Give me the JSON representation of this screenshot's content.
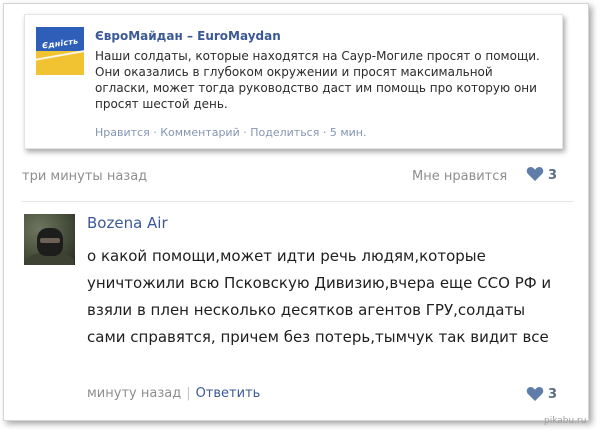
{
  "post": {
    "avatar_text": "Єдність",
    "author": "ЄвроМайдан – EuroMaydan",
    "text": "Наши солдаты, которые находятся на Саур-Могиле просят о помощи. Они оказались в глубоком окружении и просят максимальной огласки, может тогда руководство даст им помощь про которую они просят шестой день.",
    "actions": {
      "like": "Нравится",
      "comment": "Комментарий",
      "share": "Поделиться",
      "time": "5 мин.",
      "sep": "·"
    }
  },
  "comment1": {
    "time": "три минуты назад",
    "like_label": "Мне нравится",
    "likes": "3"
  },
  "comment2": {
    "author": "Bozena Air",
    "text": "о какой помощи,может идти речь людям,которые уничтожили всю Псковскую Дивизию,вчера еще ССО РФ и взяли в плен несколько десятков агентов ГРУ,солдаты сами справятся, причем без потерь,тымчук так видит все",
    "time": "минуту назад",
    "pipe": "|",
    "reply": "Ответить",
    "likes": "3"
  },
  "watermark": "pikabu.ru",
  "colors": {
    "link": "#3b5998",
    "muted": "#8e8e8e",
    "heart": "#5f7da8",
    "action_link": "#8496b3"
  }
}
